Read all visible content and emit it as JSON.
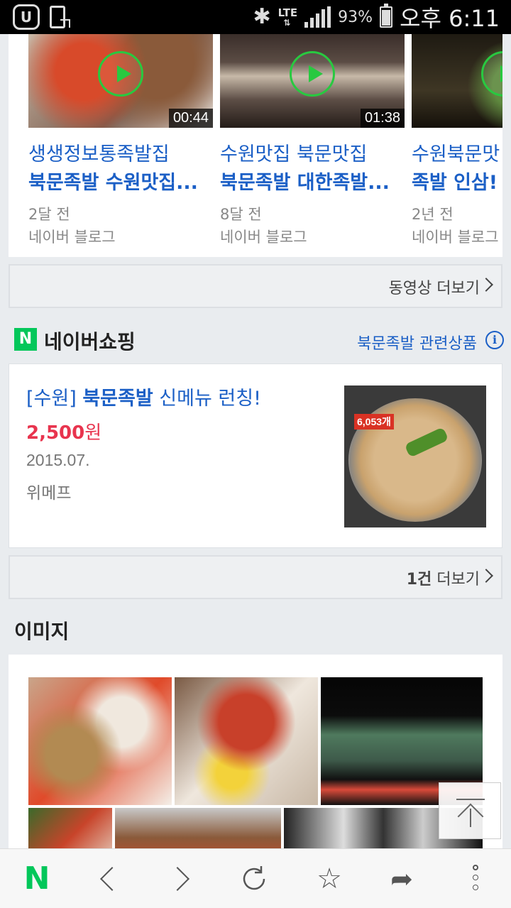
{
  "status_bar": {
    "network": "LTE",
    "battery": "93%",
    "time": "오후 6:11"
  },
  "videos": [
    {
      "duration": "00:44",
      "title_line1": "생생정보통족발집",
      "title_line2": "북문족발 수원맛집...",
      "age": "2달 전",
      "source": "네이버 블로그"
    },
    {
      "duration": "01:38",
      "title_line1": "수원맛집 북문맛집",
      "title_line2": "북문족발 대한족발...",
      "age": "8달 전",
      "source": "네이버 블로그"
    },
    {
      "duration": "",
      "title_line1": "수원북문맛",
      "title_line2": "족발 인삼!",
      "age": "2년 전",
      "source": "네이버 블로그"
    }
  ],
  "video_more": "동영상 더보기",
  "shopping": {
    "logo_letter": "N",
    "title": "네이버쇼핑",
    "related": "북문족발 관련상품",
    "info_icon": "i",
    "product": {
      "title_prefix": "[수원] ",
      "title_bold": "북문족발",
      "title_suffix": " 신메뉴 런칭!",
      "price_value": "2,500",
      "price_unit": "원",
      "date": "2015.07.",
      "seller": "위메프",
      "image_tag": "6,053개"
    },
    "more_count": "1건",
    "more_label": " 더보기"
  },
  "images_section": {
    "title": "이미지"
  },
  "toolbar": {
    "home": "N",
    "bookmark_icon": "☆",
    "share_icon": "➦"
  }
}
